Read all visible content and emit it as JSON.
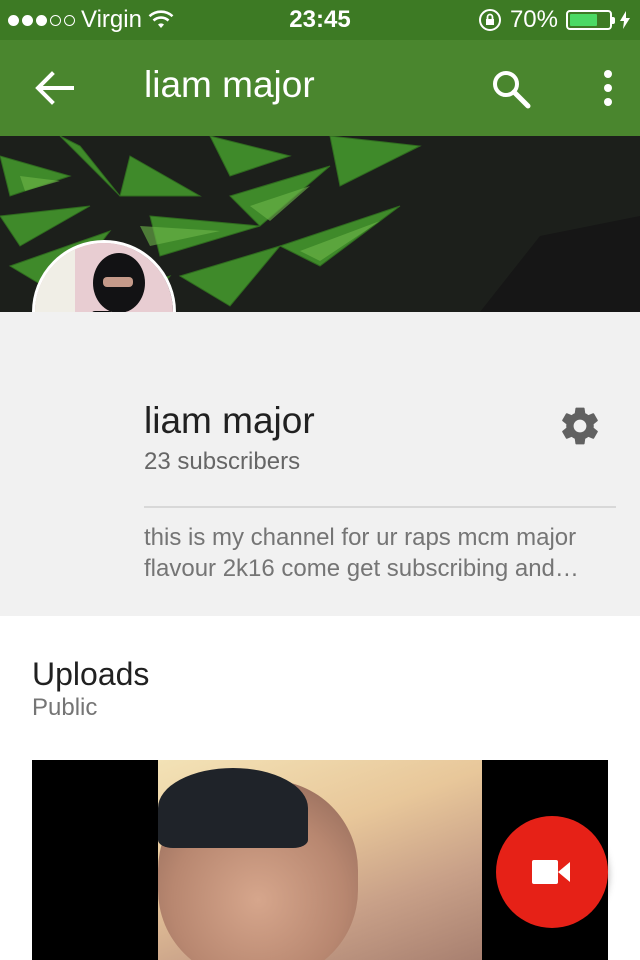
{
  "status_bar": {
    "carrier": "Virgin",
    "time": "23:45",
    "battery_percent": "70%",
    "battery_level": 0.7,
    "signal_bars_filled": 3,
    "signal_bars_total": 5
  },
  "app_bar": {
    "title": "liam major",
    "back_icon": "arrow-left-icon",
    "search_icon": "search-icon",
    "more_icon": "more-vertical-icon"
  },
  "channel": {
    "name": "liam major",
    "subscribers": "23 subscribers",
    "description_line1": "this is my channel for ur raps mcm major",
    "description_line2": "flavour 2k16 come get subscribing and…",
    "settings_icon": "gear-icon"
  },
  "uploads": {
    "heading": "Uploads",
    "visibility": "Public"
  },
  "fab": {
    "icon": "video-camera-icon",
    "color": "#e62117"
  },
  "colors": {
    "status_bar": "#3d7a24",
    "app_bar": "#4a862e",
    "accent_red": "#e62117"
  }
}
